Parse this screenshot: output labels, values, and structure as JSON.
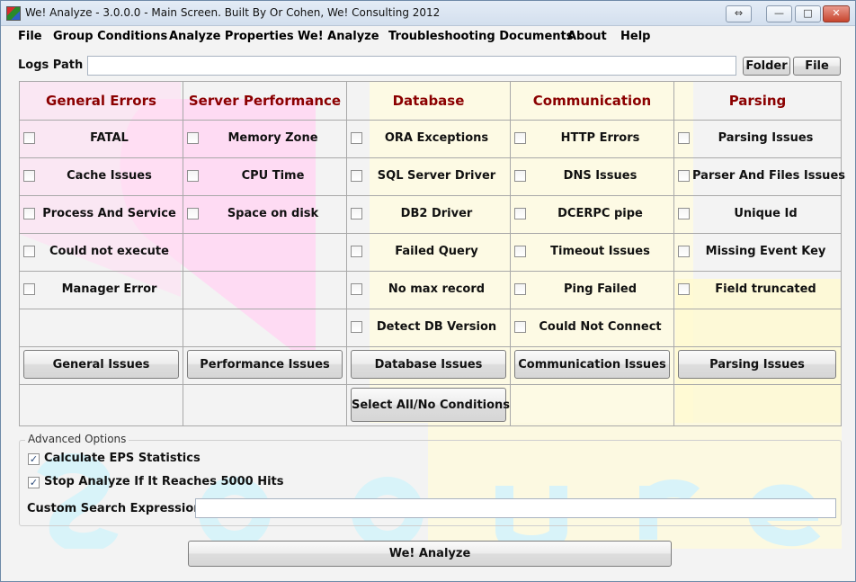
{
  "window": {
    "title": "We! Analyze - 3.0.0.0 - Main Screen. Built By Or Cohen, We! Consulting 2012",
    "controls": {
      "restore": "⇔",
      "minimize": "—",
      "maximize": "□",
      "close": "✕"
    }
  },
  "menu": [
    "File",
    "Group Conditions",
    "Analyze Properties",
    "We! Analyze",
    "Troubleshooting Documents",
    "About",
    "Help"
  ],
  "logs": {
    "label": "Logs Path",
    "value": "",
    "folder_button": "Folder",
    "file_button": "File"
  },
  "columns": [
    {
      "header": "General Errors",
      "items": [
        "FATAL",
        "Cache Issues",
        "Process And Service",
        "Could not execute",
        "Manager Error"
      ],
      "button": "General Issues"
    },
    {
      "header": "Server Performance",
      "items": [
        "Memory Zone",
        "CPU Time",
        "Space on disk"
      ],
      "button": "Performance Issues"
    },
    {
      "header": "Database",
      "items": [
        "ORA Exceptions",
        "SQL Server Driver",
        "DB2 Driver",
        "Failed Query",
        "No max record",
        "Detect DB Version"
      ],
      "button": "Database Issues"
    },
    {
      "header": "Communication",
      "items": [
        "HTTP Errors",
        "DNS Issues",
        "DCERPC pipe",
        "Timeout Issues",
        "Ping Failed",
        "Could Not Connect"
      ],
      "button": "Communication Issues"
    },
    {
      "header": "Parsing",
      "items": [
        "Parsing Issues",
        "Parser And Files Issues",
        "Unique Id",
        "Missing Event Key",
        "Field truncated"
      ],
      "button": "Parsing Issues"
    }
  ],
  "select_all_button": "Select All/No Conditions",
  "advanced": {
    "title": "Advanced Options",
    "options": [
      {
        "label": "Calculate EPS Statistics",
        "checked": true
      },
      {
        "label": "Stop Analyze If It Reaches 5000 Hits",
        "checked": true
      }
    ],
    "custom_search_label": "Custom Search Expression:",
    "custom_search_value": ""
  },
  "analyze_button": "We! Analyze",
  "colors": {
    "header_text": "#8b0000",
    "watermark_pink": "#ffd6f2",
    "watermark_yellow": "#fffcd6",
    "watermark_cyan": "#e2f7fb"
  }
}
